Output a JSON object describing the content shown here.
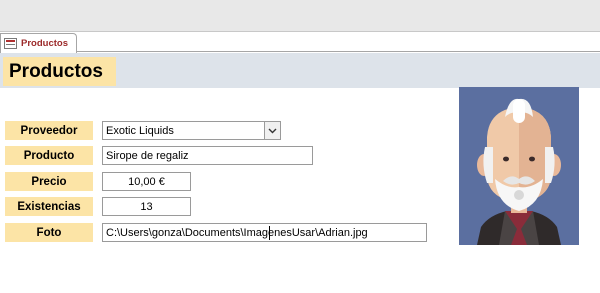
{
  "window": {
    "tab_label": "Productos"
  },
  "form": {
    "title": "Productos",
    "fields": {
      "proveedor": {
        "label": "Proveedor",
        "value": "Exotic Liquids"
      },
      "producto": {
        "label": "Producto",
        "value": "Sirope de regaliz"
      },
      "precio": {
        "label": "Precio",
        "value": "10,00 €"
      },
      "existencias": {
        "label": "Existencias",
        "value": "13"
      },
      "foto": {
        "label": "Foto",
        "value": "C:\\Users\\gonza\\Documents\\ImagenesUsar\\Adrian.jpg"
      }
    }
  },
  "icons": {
    "form_tab": "form-icon",
    "dropdown": "chevron-down-icon",
    "photo": "avatar-image"
  },
  "colors": {
    "label_bg": "#fce4a6",
    "header_bg": "#dde3ea",
    "tab_text": "#9c2a2a",
    "photo_bg": "#5b6fa0"
  }
}
